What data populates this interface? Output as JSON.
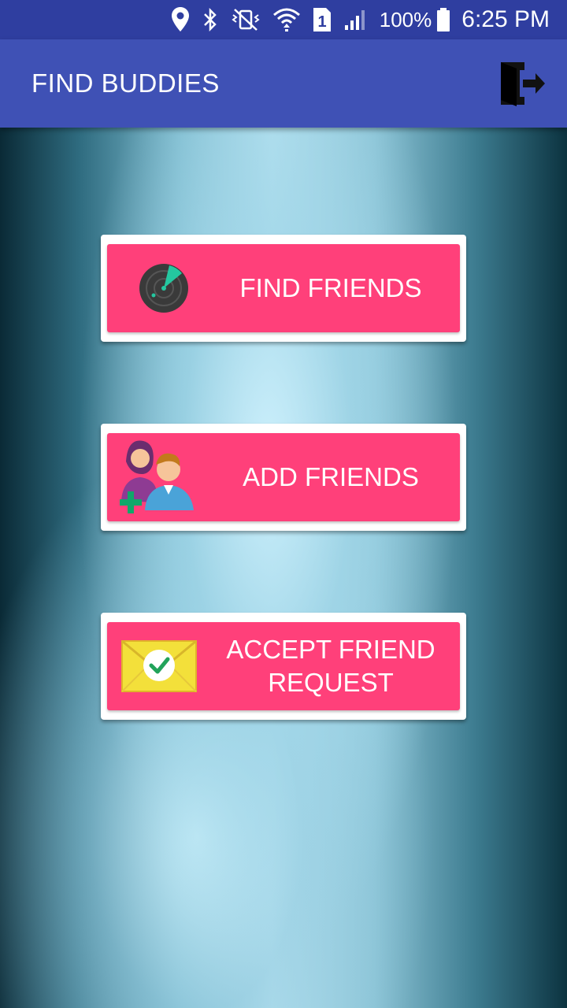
{
  "status_bar": {
    "battery": "100%",
    "time": "6:25 PM",
    "sim_slot": "1",
    "icons": [
      "location-icon",
      "bluetooth-icon",
      "vibrate-icon",
      "wifi-icon",
      "sim-icon",
      "signal-icon",
      "battery-icon"
    ]
  },
  "app_bar": {
    "title": "FIND BUDDIES",
    "exit_icon": "exit-door-icon"
  },
  "menu": [
    {
      "label": "FIND FRIENDS",
      "icon": "radar-icon"
    },
    {
      "label": "ADD FRIENDS",
      "icon": "add-friends-icon"
    },
    {
      "label": "ACCEPT FRIEND\nREQUEST",
      "icon": "envelope-check-icon"
    }
  ],
  "colors": {
    "status_bar": "#2f3ea0",
    "app_bar": "#3f51b5",
    "button": "#ff407a",
    "button_border": "#ffffff"
  }
}
